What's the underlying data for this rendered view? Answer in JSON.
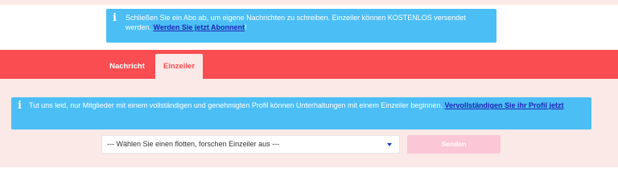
{
  "top_notice": {
    "icon": "info-icon",
    "text": "Schließen Sie ein Abo ab, um eigene Nachrichten zu schreiben. Einzeiler können KOSTENLOS versendet werden. ",
    "link": "Werden Sie jetzt Abonnent",
    "suffix": "!"
  },
  "tabs": [
    {
      "label": "Nachricht",
      "active": false
    },
    {
      "label": "Einzeiler",
      "active": true
    }
  ],
  "lower_notice": {
    "icon": "info-icon",
    "text": "Tut uns leid, nur Mitglieder mit einem vollständigen und genehmigten Profil können Unterhaltungen mit einem Einzeiler beginnen. ",
    "link": "Vervollständigen Sie ihr Profil jetzt"
  },
  "einzeiler_select": {
    "selected": "--- Wählen Sie einen flotten, forschen Einzeiler aus ---"
  },
  "send_button": {
    "label": "Senden"
  },
  "colors": {
    "nav": "#fa4d52",
    "info": "#4bbef5",
    "link": "#1f25b5",
    "send_disabled": "#fbc6d6",
    "background": "#fbe9e7"
  }
}
